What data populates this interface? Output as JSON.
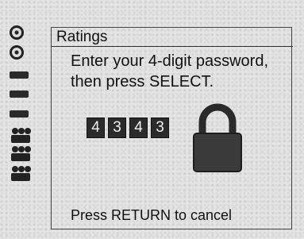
{
  "sidebar": {
    "items": [
      {
        "icon": "disc-icon"
      },
      {
        "icon": "disc-icon"
      },
      {
        "icon": "tape-icon"
      },
      {
        "icon": "tape-icon"
      },
      {
        "icon": "tape-icon"
      },
      {
        "icon": "people-icon"
      },
      {
        "icon": "people-icon"
      },
      {
        "icon": "people-icon"
      }
    ]
  },
  "panel": {
    "title": "Ratings",
    "prompt_line1": "Enter your 4-digit password,",
    "prompt_line2": "then press SELECT.",
    "digits": [
      "4",
      "3",
      "4",
      "3"
    ],
    "footer": "Press RETURN to cancel"
  },
  "colors": {
    "background": "#e4e4e4",
    "text": "#111111",
    "digit_box": "#2b2b2b"
  }
}
